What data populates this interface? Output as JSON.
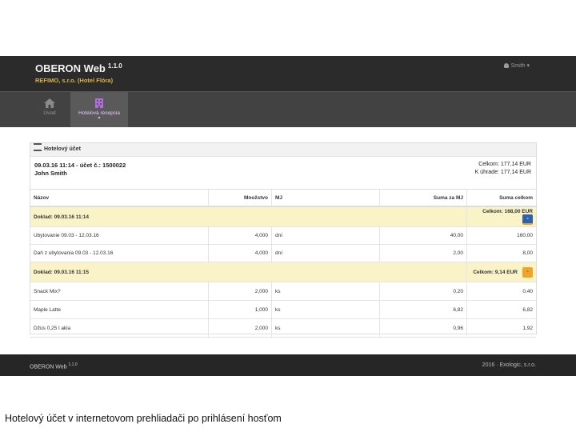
{
  "header": {
    "app_name": "OBERON Web",
    "version": "1.1.0",
    "subtitle": "REFIMO, s.r.o. (Hotel Flóra)",
    "user": "Smith"
  },
  "nav": {
    "home": "Úvod",
    "reception": "Hotelová recepcia"
  },
  "card": {
    "title": "Hotelový účet",
    "bill_line1": "09.03.16 11:14 - účet č.: 1500022",
    "guest": "John Smith",
    "total_label": "Celkom: 177,14 EUR",
    "to_pay_label": "K úhrade: 177,14 EUR"
  },
  "table": {
    "headers": [
      "Názov",
      "Množstvo",
      "MJ",
      "Suma za MJ",
      "Suma celkom"
    ],
    "doc1": {
      "label": "Doklad: 09.03.16 11:14",
      "total": "Celkom: 168,00 EUR"
    },
    "doc1_items": [
      [
        "Ubytovanie 09.03 - 12.03.16",
        "4,000",
        "dní",
        "40,00",
        "160,00"
      ],
      [
        "Daň z ubytovania 09.03 - 12.03.16",
        "4,000",
        "dní",
        "2,00",
        "8,00"
      ]
    ],
    "doc2": {
      "label": "Doklad: 09.03.16 11:15",
      "total": "Celkom: 9,14 EUR"
    },
    "doc2_items": [
      [
        "Snack Mix?",
        "2,000",
        "ks",
        "0,20",
        "0,40"
      ],
      [
        "Maple Latte",
        "1,000",
        "ks",
        "6,82",
        "6,82"
      ],
      [
        "Džús 0,25 l akla",
        "2,000",
        "ks",
        "0,96",
        "1,92"
      ]
    ]
  },
  "footer": {
    "app_name": "OBERON Web",
    "version": "1.1.0",
    "copyright": "2016 · Exologic, s.r.o."
  },
  "caption": "Hotelový účet v internetovom prehliadači po prihlásení hosťom",
  "colors": {
    "topbar": "#2b2b2b",
    "subtitle": "#d9b24a",
    "doc_row": "#fbf3c8",
    "blue_button": "#2d62b0",
    "orange_button": "#f0a42a"
  }
}
